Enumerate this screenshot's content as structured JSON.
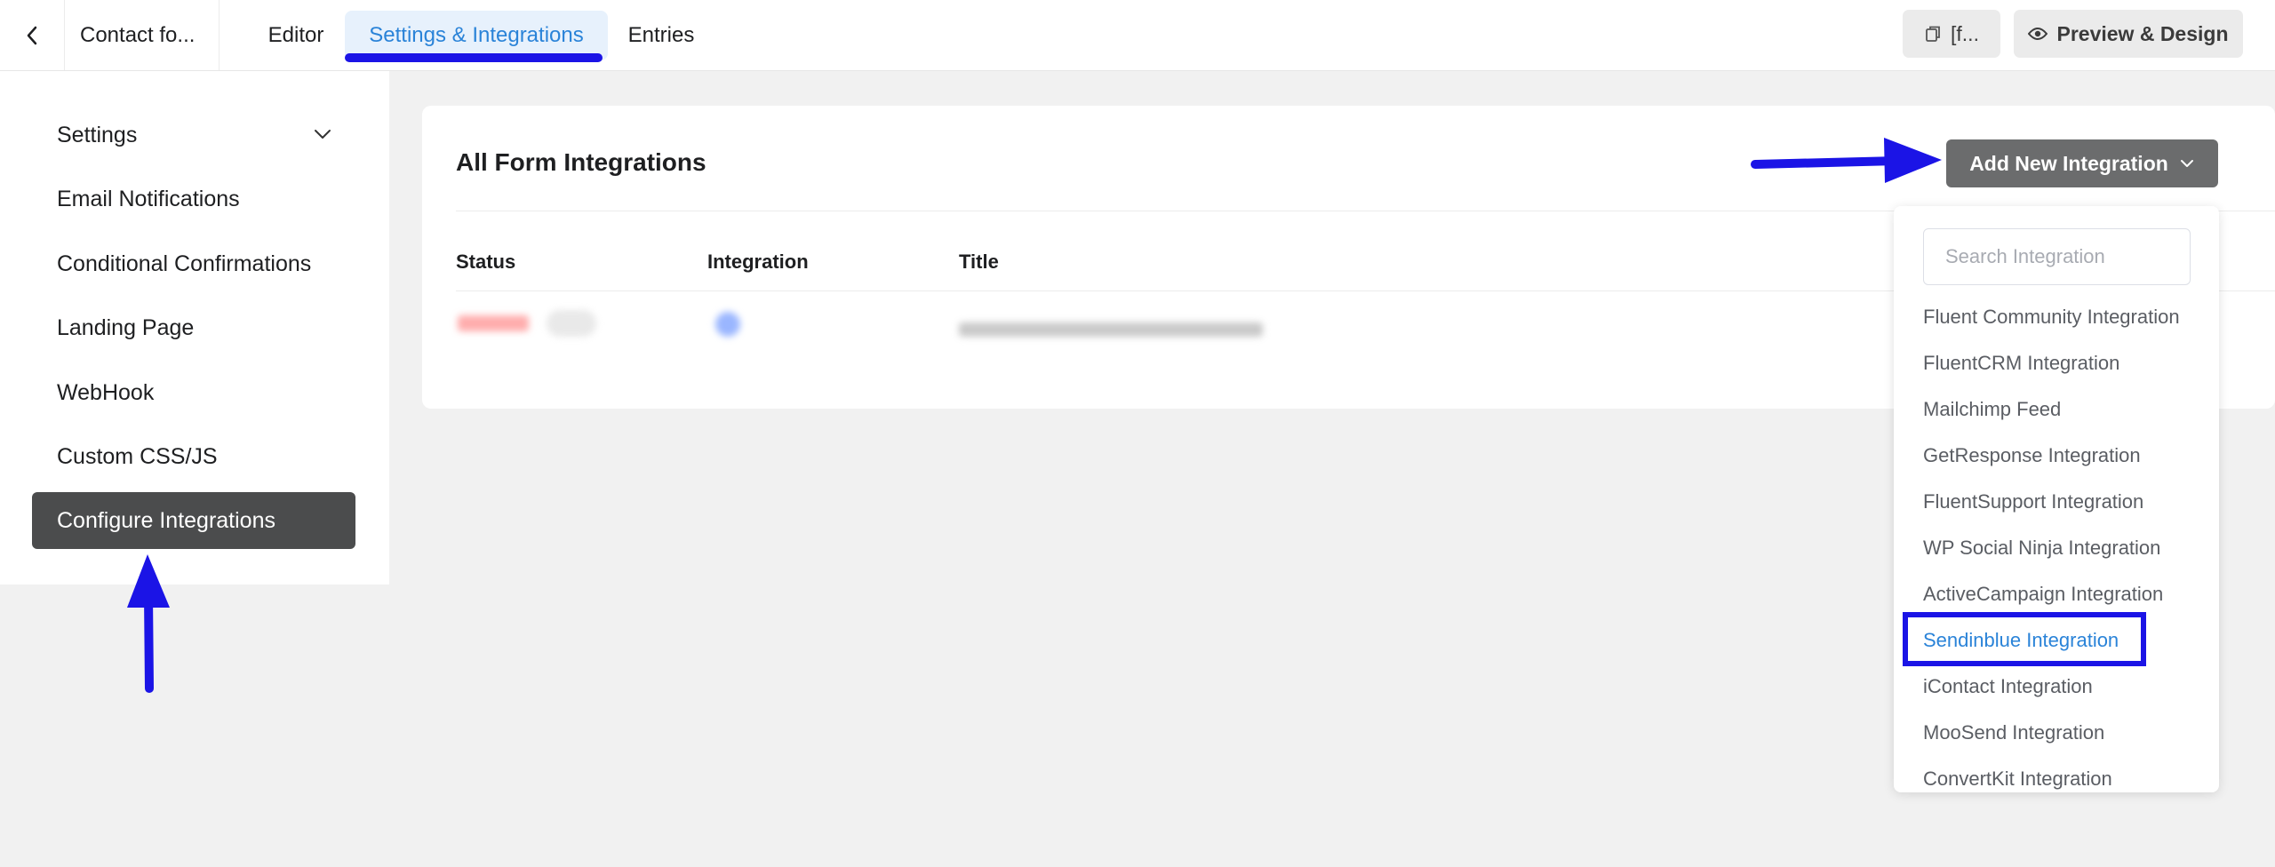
{
  "topbar": {
    "form_name": "Contact fo...",
    "tabs": [
      {
        "label": "Editor"
      },
      {
        "label": "Settings & Integrations"
      },
      {
        "label": "Entries"
      }
    ],
    "shortcode_label": "[f...",
    "preview_label": "Preview & Design"
  },
  "sidebar": {
    "items": [
      {
        "label": "Settings"
      },
      {
        "label": "Email Notifications"
      },
      {
        "label": "Conditional Confirmations"
      },
      {
        "label": "Landing Page"
      },
      {
        "label": "WebHook"
      },
      {
        "label": "Custom CSS/JS"
      },
      {
        "label": "Configure Integrations"
      }
    ]
  },
  "main": {
    "title": "All Form Integrations",
    "add_button": "Add New Integration",
    "columns": [
      "Status",
      "Integration",
      "Title"
    ],
    "search_placeholder": "Search Integration",
    "integrations": [
      "Fluent Community Integration",
      "FluentCRM Integration",
      "Mailchimp Feed",
      "GetResponse Integration",
      "FluentSupport Integration",
      "WP Social Ninja Integration",
      "ActiveCampaign Integration",
      "Sendinblue Integration",
      "iContact Integration",
      "MooSend Integration",
      "ConvertKit Integration"
    ],
    "highlighted_integration": "Sendinblue Integration"
  },
  "colors": {
    "accent": "#2a83d8",
    "annotation": "#1b14e6",
    "active_sidebar": "#4b4c4d",
    "add_button": "#6b6c6d"
  }
}
